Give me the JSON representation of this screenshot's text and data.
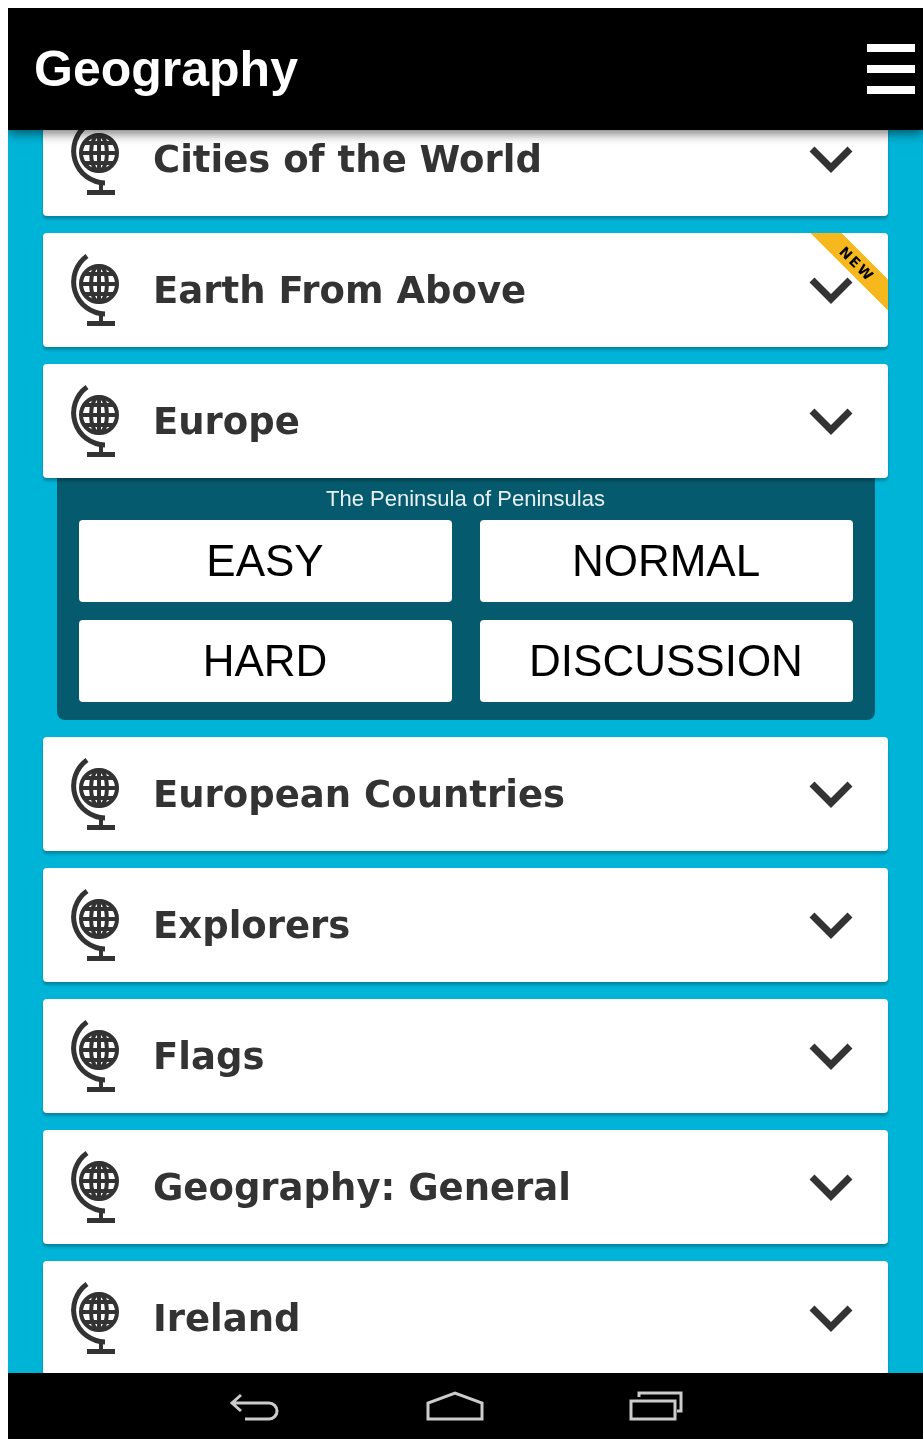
{
  "app_bar": {
    "title": "Geography"
  },
  "categories": [
    {
      "name": "Cities of the World",
      "expanded": false
    },
    {
      "name": "Earth From Above",
      "expanded": false,
      "badge": "NEW"
    },
    {
      "name": "Europe",
      "expanded": true,
      "subtitle": "The Peninsula of Peninsulas",
      "buttons": [
        "EASY",
        "NORMAL",
        "HARD",
        "DISCUSSION"
      ]
    },
    {
      "name": "European Countries",
      "expanded": false
    },
    {
      "name": "Explorers",
      "expanded": false
    },
    {
      "name": "Flags",
      "expanded": false
    },
    {
      "name": "Geography: General",
      "expanded": false
    },
    {
      "name": "Ireland",
      "expanded": false
    }
  ]
}
